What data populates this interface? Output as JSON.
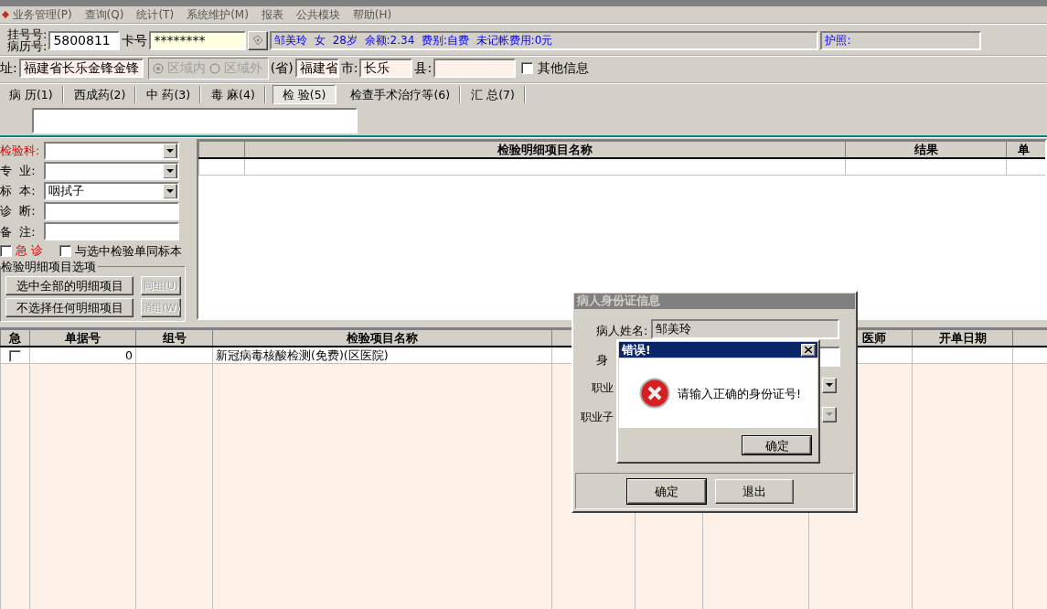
{
  "menu": [
    {
      "label": "业务管理(P)"
    },
    {
      "label": "查询(Q)"
    },
    {
      "label": "统计(T)"
    },
    {
      "label": "系统维护(M)"
    },
    {
      "label": "报表"
    },
    {
      "label": "公共模块"
    },
    {
      "label": "帮助(H)"
    }
  ],
  "patient": {
    "reg_label": "挂号号:",
    "record_label": "病历号:",
    "record_no": "5800811",
    "card_label": "卡号",
    "card_value": "********",
    "info": "邹美玲  女  28岁  余额:2.34  费别:自费  未记帐费用:0元",
    "passport_label": "护照:"
  },
  "address": {
    "label": "址:",
    "value": "福建省长乐金锋金锋",
    "region_disabled": true,
    "region_options": [
      {
        "label": "区域内",
        "selected": true
      },
      {
        "label": "区域外",
        "selected": false
      }
    ],
    "province_label": "(省)",
    "province": "福建省",
    "city_label": "市:",
    "city": "长乐",
    "county_label": "县:",
    "other_info": {
      "label": "其他信息",
      "checked": false
    }
  },
  "tabs": [
    {
      "label": "病 历(1)",
      "selected": false
    },
    {
      "label": "西成药(2)",
      "selected": false
    },
    {
      "label": "中 药(3)",
      "selected": false
    },
    {
      "label": "毒 麻(4)",
      "selected": false
    },
    {
      "label": "检 验(5)",
      "selected": true
    },
    {
      "label": "检查手术治疗等(6)",
      "selected": false
    },
    {
      "label": "汇 总(7)",
      "selected": false
    }
  ],
  "lab_form": {
    "fields": [
      {
        "label": "检验科:",
        "kind": "select",
        "required": true
      },
      {
        "label": "专  业:",
        "kind": "select",
        "required": false
      },
      {
        "label": "标  本:",
        "kind": "select",
        "required": false,
        "value": "咽拭子"
      },
      {
        "label": "诊  断:",
        "kind": "text",
        "required": false
      },
      {
        "label": "备  注:",
        "kind": "text",
        "required": false
      }
    ],
    "urgent": {
      "label": "急 诊",
      "checked": false
    },
    "same_specimen": {
      "label": "与选中检验单同标本",
      "checked": false
    },
    "group_title": "检验明细项目选项",
    "buttons": [
      {
        "label": "选中全部的明细项目",
        "disabled": false
      },
      {
        "label": "同组(U)",
        "disabled": true
      },
      {
        "label": "不选择任何明细项目",
        "disabled": false
      },
      {
        "label": "消组(W)",
        "disabled": true
      }
    ]
  },
  "detail_grid": {
    "columns": [
      "检验明细项目名称",
      "结果",
      "单"
    ]
  },
  "orders": {
    "columns": [
      {
        "label": "急"
      },
      {
        "label": "单据号"
      },
      {
        "label": "组号"
      },
      {
        "label": "检验项目名称"
      },
      {
        "label": "医师"
      },
      {
        "label": "开单日期"
      }
    ],
    "rows": [
      {
        "urgent": false,
        "number": "0",
        "name": "新冠病毒核酸检测(免费)(区医院)"
      }
    ]
  },
  "id_dialog": {
    "title": "病人身份证信息",
    "active": false,
    "name_label": "病人姓名:",
    "name_value": "邹美玲",
    "id_label": "身",
    "job_label": "职业",
    "job_sub_label": "职业子",
    "buttons": [
      "确定",
      "退出"
    ]
  },
  "error_dialog": {
    "title": "错误!",
    "message": "请输入正确的身份证号!",
    "button": "确定"
  }
}
